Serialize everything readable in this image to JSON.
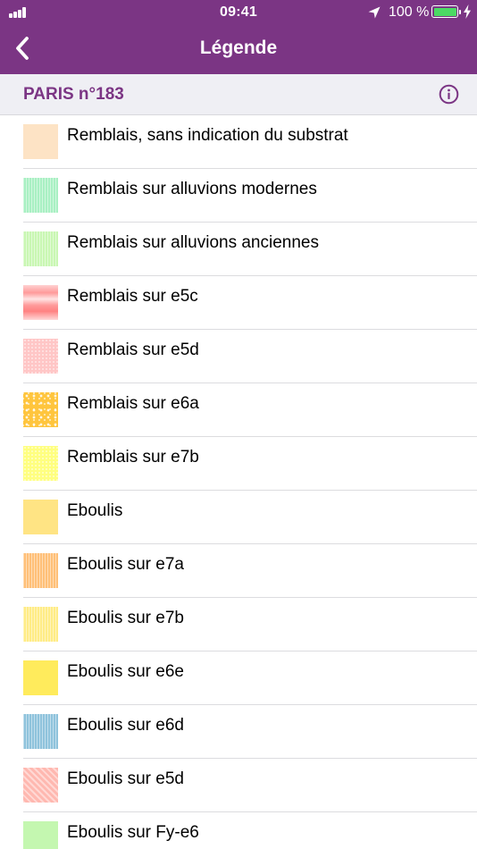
{
  "status_bar": {
    "time": "09:41",
    "battery_percent_label": "100 %",
    "battery_level": 1.0,
    "icons": [
      "signal-icon",
      "location-arrow-icon",
      "battery-icon",
      "charging-bolt-icon"
    ]
  },
  "navbar": {
    "title": "Légende",
    "back_icon": "chevron-left-icon"
  },
  "section": {
    "title": "PARIS n°183",
    "info_icon": "info-icon"
  },
  "colors": {
    "brand": "#7b3584",
    "section_background": "#efeff4",
    "battery_fill": "#4cd964"
  },
  "legend_items": [
    {
      "label": "Remblais, sans indication du substrat",
      "color": "#fde3c5",
      "pattern": "solid"
    },
    {
      "label": "Remblais sur alluvions modernes",
      "color": "#a9f0c3",
      "pattern": "vertical-stripes"
    },
    {
      "label": "Remblais sur alluvions anciennes",
      "color": "#c9f7b3",
      "pattern": "vertical-stripes"
    },
    {
      "label": "Remblais sur e5c",
      "color": "#ff9a9a",
      "pattern": "horizontal-gradient-bands"
    },
    {
      "label": "Remblais sur e5d",
      "color": "#ffc6c6",
      "pattern": "dots"
    },
    {
      "label": "Remblais sur e6a",
      "color": "#ffc53d",
      "pattern": "speckles"
    },
    {
      "label": "Remblais sur e7b",
      "color": "#ffff80",
      "pattern": "dots"
    },
    {
      "label": "Eboulis",
      "color": "#ffe484",
      "pattern": "solid"
    },
    {
      "label": "Eboulis sur e7a",
      "color": "#ffc078",
      "pattern": "vertical-stripes"
    },
    {
      "label": "Eboulis sur e7b",
      "color": "#ffec86",
      "pattern": "vertical-stripes"
    },
    {
      "label": "Eboulis sur e6e",
      "color": "#ffeb5c",
      "pattern": "solid"
    },
    {
      "label": "Eboulis sur e6d",
      "color": "#8fc3dc",
      "pattern": "vertical-stripes"
    },
    {
      "label": "Eboulis sur e5d",
      "color": "#ffb8b0",
      "pattern": "diagonal-stripes"
    },
    {
      "label": "Eboulis sur Fy-e6",
      "color": "#c4f7b0",
      "pattern": "solid"
    }
  ]
}
